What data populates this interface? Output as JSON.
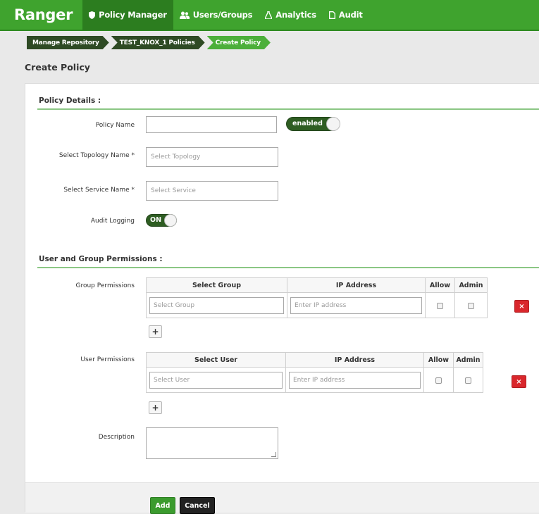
{
  "navbar": {
    "brand": "Ranger",
    "items": [
      {
        "label": "Policy Manager",
        "icon": "shield-icon",
        "active": true
      },
      {
        "label": "Users/Groups",
        "icon": "users-icon",
        "active": false
      },
      {
        "label": "Analytics",
        "icon": "analytics-icon",
        "active": false
      },
      {
        "label": "Audit",
        "icon": "document-icon",
        "active": false
      }
    ]
  },
  "breadcrumb": [
    "Manage Repository",
    "TEST_KNOX_1 Policies",
    "Create Policy"
  ],
  "page_title": "Create Policy",
  "policy_details": {
    "section_title": "Policy Details :",
    "policy_name_label": "Policy Name",
    "policy_name_value": "",
    "enabled_toggle": "enabled",
    "topology_label": "Select Topology Name *",
    "topology_placeholder": "Select Topology",
    "service_label": "Select Service Name *",
    "service_placeholder": "Select Service",
    "audit_label": "Audit Logging",
    "audit_toggle": "ON"
  },
  "permissions": {
    "section_title": "User and Group Permissions :",
    "group": {
      "label": "Group Permissions",
      "headers": [
        "Select Group",
        "IP Address",
        "Allow",
        "Admin"
      ],
      "select_placeholder": "Select Group",
      "ip_placeholder": "Enter IP address",
      "delete_label": "×",
      "add_label": "+"
    },
    "user": {
      "label": "User Permissions",
      "headers": [
        "Select User",
        "IP Address",
        "Allow",
        "Admin"
      ],
      "select_placeholder": "Select User",
      "ip_placeholder": "Enter IP address",
      "delete_label": "×",
      "add_label": "+"
    }
  },
  "description_label": "Description",
  "buttons": {
    "add": "Add",
    "cancel": "Cancel"
  },
  "colors": {
    "navbar": "#3fa32e",
    "navbar_active": "#2c7d1f",
    "crumb": "#2e4a24",
    "crumb_current": "#4caf3a",
    "danger": "#d9272c"
  }
}
